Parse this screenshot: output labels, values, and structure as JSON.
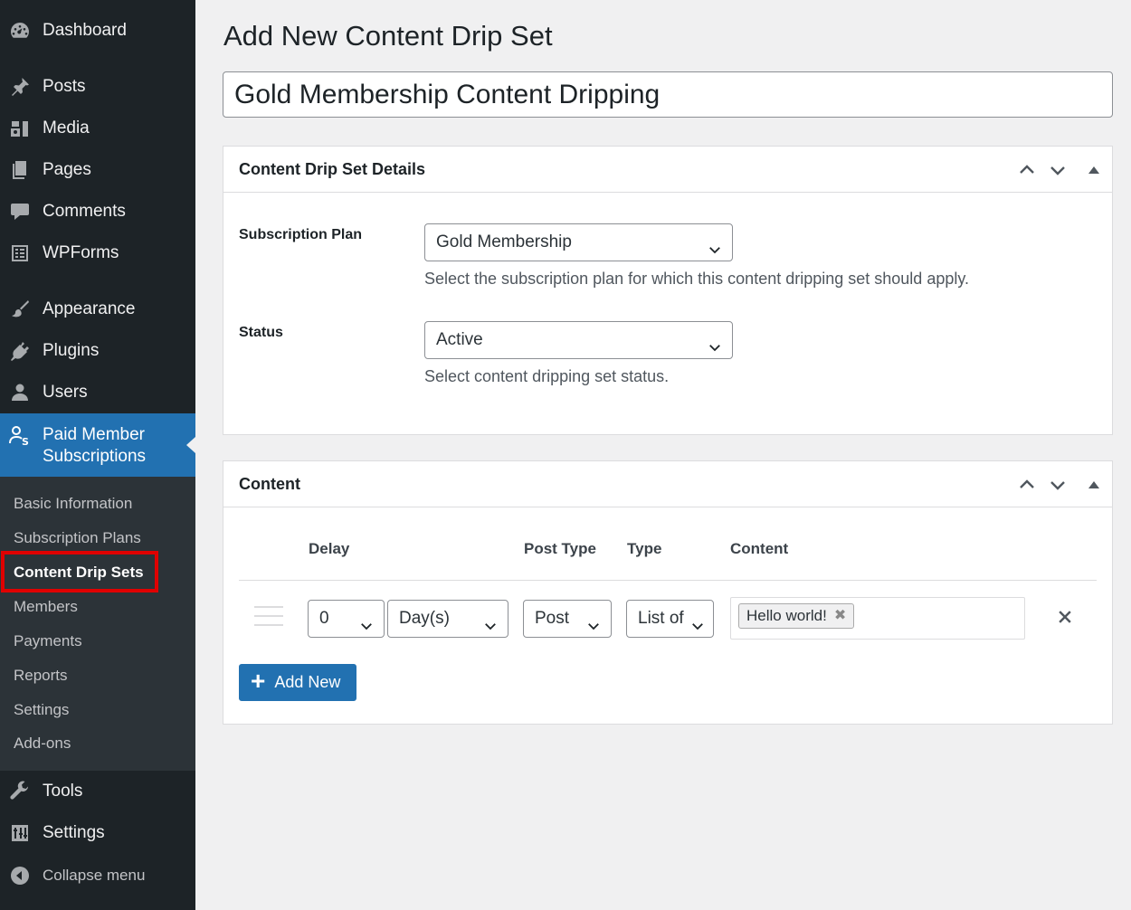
{
  "sidebar": {
    "items": [
      {
        "label": "Dashboard",
        "icon": "dashboard-icon"
      },
      {
        "label": "Posts",
        "icon": "pin-icon"
      },
      {
        "label": "Media",
        "icon": "media-icon"
      },
      {
        "label": "Pages",
        "icon": "pages-icon"
      },
      {
        "label": "Comments",
        "icon": "comment-icon"
      },
      {
        "label": "WPForms",
        "icon": "forms-icon"
      },
      {
        "label": "Appearance",
        "icon": "paintbrush-icon"
      },
      {
        "label": "Plugins",
        "icon": "plugin-icon"
      },
      {
        "label": "Users",
        "icon": "user-icon"
      },
      {
        "label": "Paid Member\nSubscriptions",
        "label_line1": "Paid Member",
        "label_line2": "Subscriptions",
        "icon": "members-icon"
      },
      {
        "label": "Tools",
        "icon": "wrench-icon"
      },
      {
        "label": "Settings",
        "icon": "settings-icon"
      },
      {
        "label": "Collapse menu",
        "icon": "collapse-icon"
      }
    ],
    "submenu": [
      "Basic Information",
      "Subscription Plans",
      "Content Drip Sets",
      "Members",
      "Payments",
      "Reports",
      "Settings",
      "Add-ons"
    ]
  },
  "main": {
    "page_title": "Add New Content Drip Set",
    "title_value": "Gold Membership Content Dripping",
    "details_panel": {
      "title": "Content Drip Set Details",
      "subscription_plan_label": "Subscription Plan",
      "subscription_plan_value": "Gold Membership",
      "subscription_plan_desc": "Select the subscription plan for which this content dripping set should apply.",
      "status_label": "Status",
      "status_value": "Active",
      "status_desc": "Select content dripping set status."
    },
    "content_panel": {
      "title": "Content",
      "columns": [
        "Delay",
        "Post Type",
        "Type",
        "Content"
      ],
      "row": {
        "delay_value": "0",
        "delay_unit": "Day(s)",
        "post_type": "Post",
        "type": "List of",
        "content_tag": "Hello world!",
        "tag_remove": "✖"
      },
      "add_new_label": "Add New"
    }
  },
  "colors": {
    "sidebar_bg": "#1d2327",
    "submenu_bg": "#2c3338",
    "accent": "#2271b1",
    "highlight": "#e00000"
  }
}
